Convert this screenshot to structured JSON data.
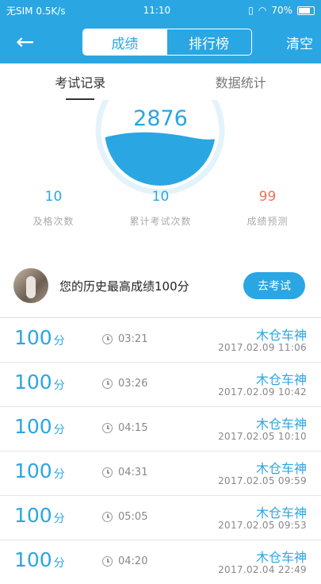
{
  "status": {
    "left": "无SIM 0.5K/s",
    "time": "11:10",
    "battery": "70%"
  },
  "header": {
    "tabs": [
      "成绩",
      "排行榜"
    ],
    "clear": "清空"
  },
  "subtabs": [
    "考试记录",
    "数据统计"
  ],
  "gauge": {
    "score": "2876",
    "fill_fraction": 0.45
  },
  "stats": [
    {
      "value": "10",
      "label": "及格次数"
    },
    {
      "value": "10",
      "label": "累计考试次数"
    },
    {
      "value": "99",
      "label": "成绩预测"
    }
  ],
  "highest": {
    "text": "您的历史最高成绩100分",
    "button": "去考试"
  },
  "records": [
    {
      "score": "100",
      "unit": "分",
      "duration": "03:21",
      "name": "木仓车神",
      "date": "2017.02.09  11:06"
    },
    {
      "score": "100",
      "unit": "分",
      "duration": "03:26",
      "name": "木仓车神",
      "date": "2017.02.09  10:42"
    },
    {
      "score": "100",
      "unit": "分",
      "duration": "04:15",
      "name": "木仓车神",
      "date": "2017.02.05  10:10"
    },
    {
      "score": "100",
      "unit": "分",
      "duration": "04:31",
      "name": "木仓车神",
      "date": "2017.02.05  09:59"
    },
    {
      "score": "100",
      "unit": "分",
      "duration": "05:05",
      "name": "木仓车神",
      "date": "2017.02.05  09:53"
    },
    {
      "score": "100",
      "unit": "分",
      "duration": "04:20",
      "name": "木仓车神",
      "date": "2017.02.04  22:49"
    }
  ]
}
